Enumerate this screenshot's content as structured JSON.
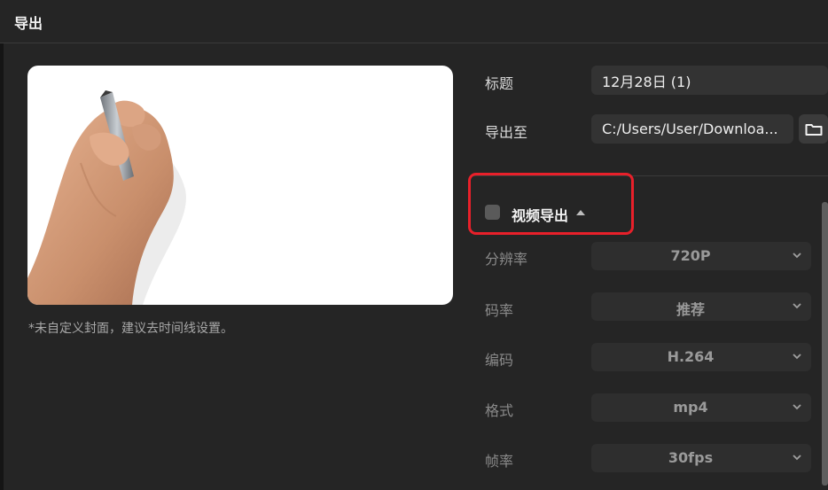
{
  "dialog": {
    "title": "导出"
  },
  "preview": {
    "cover_note": "*未自定义封面，建议去时间线设置。"
  },
  "fields": {
    "title_label": "标题",
    "title_value": "12月28日 (1)",
    "export_to_label": "导出至",
    "export_path": "C:/Users/User/Downloa..."
  },
  "video_export": {
    "section_label": "视频导出",
    "checked": false,
    "settings": [
      {
        "label": "分辨率",
        "value": "720P"
      },
      {
        "label": "码率",
        "value": "推荐"
      },
      {
        "label": "编码",
        "value": "H.264"
      },
      {
        "label": "格式",
        "value": "mp4"
      },
      {
        "label": "帧率",
        "value": "30fps"
      }
    ]
  },
  "colors": {
    "background": "#252525",
    "field": "#333333",
    "highlight": "#e8202a"
  }
}
